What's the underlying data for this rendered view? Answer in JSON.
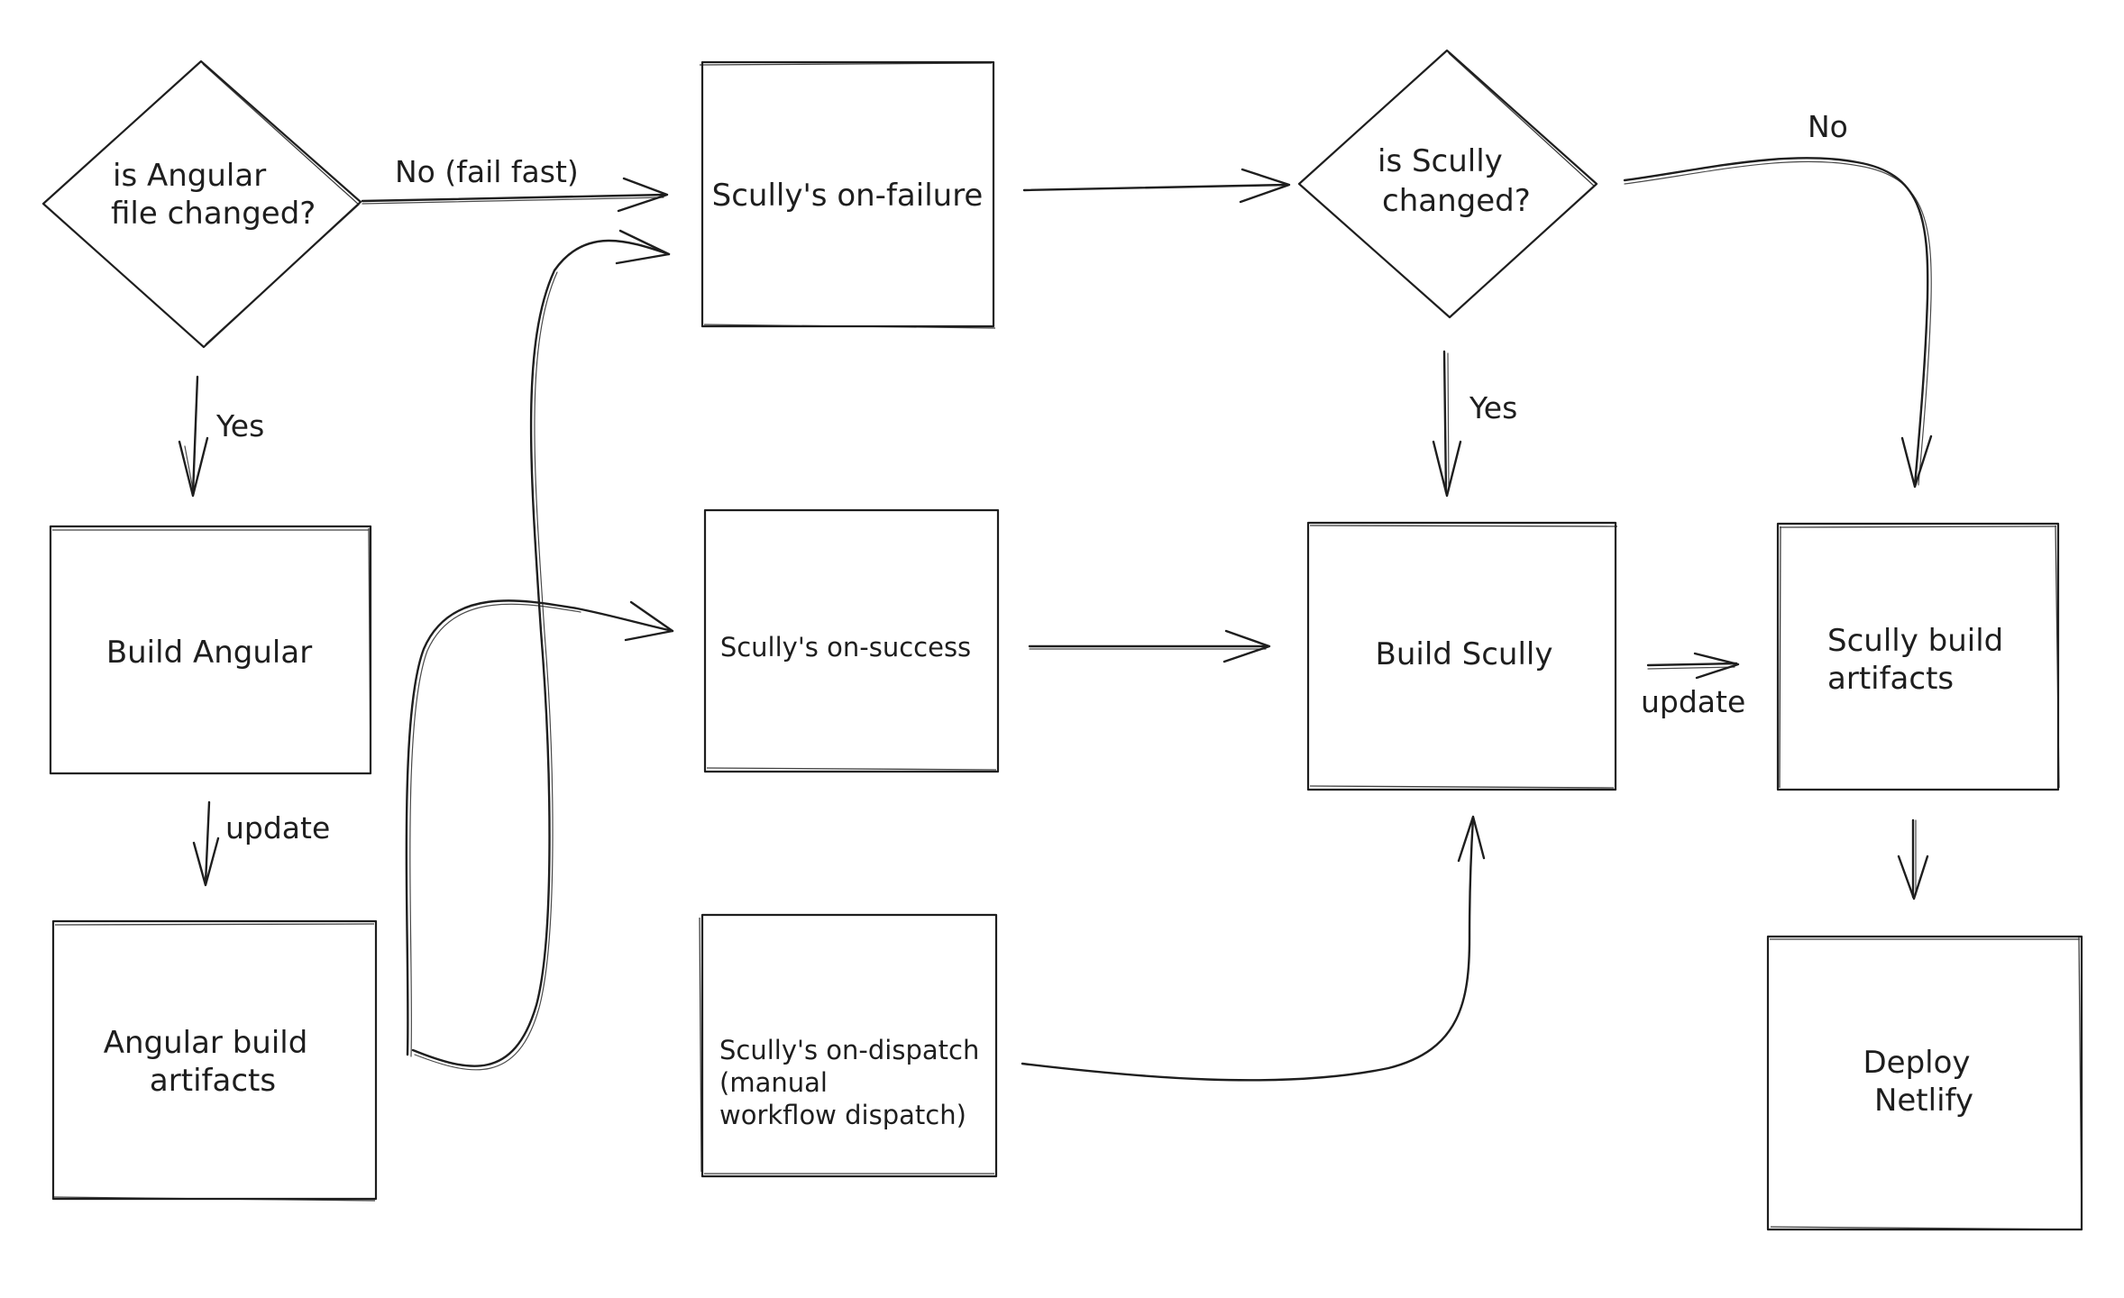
{
  "diagram": {
    "type": "flowchart",
    "style": "hand-drawn sketch",
    "colors": {
      "stroke": "#1e1e1e",
      "background": "#ffffff"
    },
    "nodes": {
      "angular_changed": {
        "shape": "diamond",
        "lines": [
          "is Angular",
          "file changed?"
        ]
      },
      "on_failure": {
        "shape": "rectangle",
        "lines": [
          "Scully's on-failure"
        ]
      },
      "scully_changed": {
        "shape": "diamond",
        "lines": [
          "is Scully",
          "changed?"
        ]
      },
      "build_angular": {
        "shape": "rectangle",
        "lines": [
          "Build Angular"
        ]
      },
      "on_success": {
        "shape": "rectangle",
        "lines": [
          "Scully's on-success"
        ]
      },
      "build_scully": {
        "shape": "rectangle",
        "lines": [
          "Build Scully"
        ]
      },
      "scully_artifacts": {
        "shape": "rectangle",
        "lines": [
          "Scully build",
          "artifacts"
        ]
      },
      "angular_artifacts": {
        "shape": "rectangle",
        "lines": [
          "Angular build",
          "artifacts"
        ]
      },
      "on_dispatch": {
        "shape": "rectangle",
        "lines": [
          "Scully's on-dispatch",
          "(manual",
          "workflow dispatch)"
        ]
      },
      "deploy_netlify": {
        "shape": "rectangle",
        "lines": [
          "Deploy",
          "Netlify"
        ]
      }
    },
    "edges": [
      {
        "from": "angular_changed",
        "to": "on_failure",
        "label": "No (fail fast)"
      },
      {
        "from": "angular_changed",
        "to": "build_angular",
        "label": "Yes"
      },
      {
        "from": "build_angular",
        "to": "angular_artifacts",
        "label": "update"
      },
      {
        "from": "angular_artifacts",
        "to": "on_failure",
        "label": ""
      },
      {
        "from": "angular_artifacts",
        "to": "on_success",
        "label": ""
      },
      {
        "from": "on_failure",
        "to": "scully_changed",
        "label": ""
      },
      {
        "from": "scully_changed",
        "to": "build_scully",
        "label": "Yes"
      },
      {
        "from": "scully_changed",
        "to": "scully_artifacts",
        "label": "No"
      },
      {
        "from": "on_success",
        "to": "build_scully",
        "label": ""
      },
      {
        "from": "on_dispatch",
        "to": "build_scully",
        "label": ""
      },
      {
        "from": "build_scully",
        "to": "scully_artifacts",
        "label": "update"
      },
      {
        "from": "scully_artifacts",
        "to": "deploy_netlify",
        "label": ""
      }
    ]
  }
}
